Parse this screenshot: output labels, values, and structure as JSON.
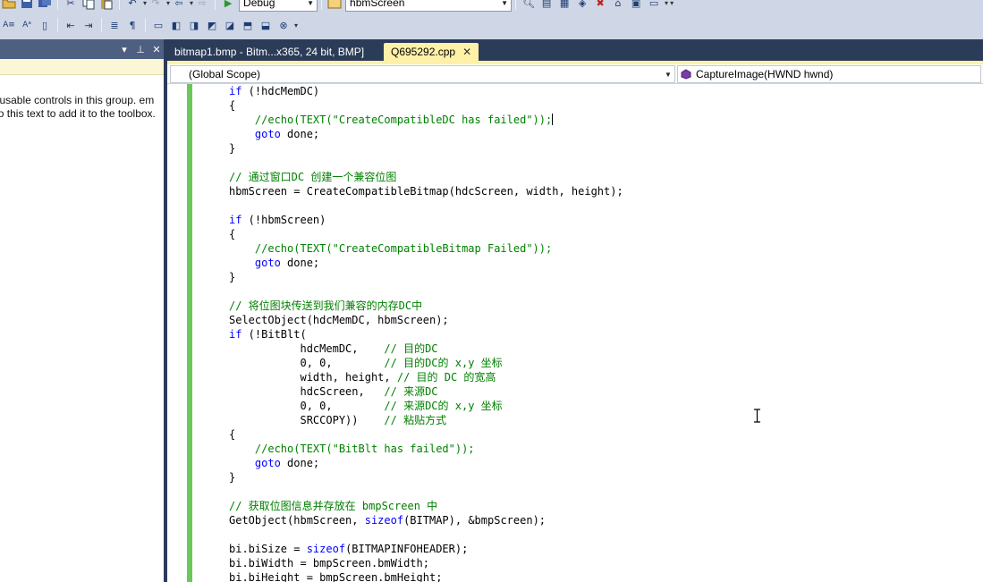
{
  "toolbar": {
    "config_value": "Debug",
    "find_value": "hbmScreen"
  },
  "toolbox": {
    "message": "no usable controls in this group. em onto this text to add it to the toolbox."
  },
  "tabs": [
    {
      "label": "bitmap1.bmp - Bitm...x365, 24 bit, BMP]",
      "active": false
    },
    {
      "label": "Q695292.cpp",
      "active": true
    }
  ],
  "editor": {
    "scope": "(Global Scope)",
    "member": "CaptureImage(HWND hwnd)",
    "lines": [
      [
        {
          "t": "if",
          "c": "kw"
        },
        {
          "t": " (!hdcMemDC)"
        }
      ],
      [
        {
          "t": "{"
        }
      ],
      [
        {
          "t": "    //echo(TEXT(\"CreateCompatibleDC has failed\"));",
          "c": "cm"
        },
        {
          "caret": true
        }
      ],
      [
        {
          "t": "    "
        },
        {
          "t": "goto",
          "c": "kw"
        },
        {
          "t": " done;"
        }
      ],
      [
        {
          "t": "}"
        }
      ],
      [],
      [
        {
          "t": "// 通过窗口DC 创建一个兼容位图",
          "c": "cm"
        }
      ],
      [
        {
          "t": "hbmScreen = CreateCompatibleBitmap(hdcScreen, width, height);"
        }
      ],
      [],
      [
        {
          "t": "if",
          "c": "kw"
        },
        {
          "t": " (!hbmScreen)"
        }
      ],
      [
        {
          "t": "{"
        }
      ],
      [
        {
          "t": "    //echo(TEXT(\"CreateCompatibleBitmap Failed\"));",
          "c": "cm"
        }
      ],
      [
        {
          "t": "    "
        },
        {
          "t": "goto",
          "c": "kw"
        },
        {
          "t": " done;"
        }
      ],
      [
        {
          "t": "}"
        }
      ],
      [],
      [
        {
          "t": "// 将位图块传送到我们兼容的内存DC中",
          "c": "cm"
        }
      ],
      [
        {
          "t": "SelectObject(hdcMemDC, hbmScreen);"
        }
      ],
      [
        {
          "t": "if",
          "c": "kw"
        },
        {
          "t": " (!BitBlt("
        }
      ],
      [
        {
          "t": "           hdcMemDC,    "
        },
        {
          "t": "// 目的DC",
          "c": "cm"
        }
      ],
      [
        {
          "t": "           0, 0,        "
        },
        {
          "t": "// 目的DC的 x,y 坐标",
          "c": "cm"
        }
      ],
      [
        {
          "t": "           width, height, "
        },
        {
          "t": "// 目的 DC 的宽高",
          "c": "cm"
        }
      ],
      [
        {
          "t": "           hdcScreen,   "
        },
        {
          "t": "// 来源DC",
          "c": "cm"
        }
      ],
      [
        {
          "t": "           0, 0,        "
        },
        {
          "t": "// 来源DC的 x,y 坐标",
          "c": "cm"
        }
      ],
      [
        {
          "t": "           SRCCOPY))    "
        },
        {
          "t": "// 粘贴方式",
          "c": "cm"
        }
      ],
      [
        {
          "t": "{"
        }
      ],
      [
        {
          "t": "    //echo(TEXT(\"BitBlt has failed\"));",
          "c": "cm"
        }
      ],
      [
        {
          "t": "    "
        },
        {
          "t": "goto",
          "c": "kw"
        },
        {
          "t": " done;"
        }
      ],
      [
        {
          "t": "}"
        }
      ],
      [],
      [
        {
          "t": "// 获取位图信息并存放在 bmpScreen 中",
          "c": "cm"
        }
      ],
      [
        {
          "t": "GetObject(hbmScreen, "
        },
        {
          "t": "sizeof",
          "c": "kw"
        },
        {
          "t": "(BITMAP), &bmpScreen);"
        }
      ],
      [],
      [
        {
          "t": "bi.biSize = "
        },
        {
          "t": "sizeof",
          "c": "kw"
        },
        {
          "t": "(BITMAPINFOHEADER);"
        }
      ],
      [
        {
          "t": "bi.biWidth = bmpScreen.bmWidth;"
        }
      ],
      [
        {
          "t": "bi.biHeight = bmpScreen.bmHeight;"
        }
      ]
    ]
  },
  "colors": {
    "keyword": "#0000ff",
    "comment": "#008000",
    "active_tab": "#fff1a8",
    "chrome": "#2b3c59",
    "change_bar": "#6ac85a"
  }
}
